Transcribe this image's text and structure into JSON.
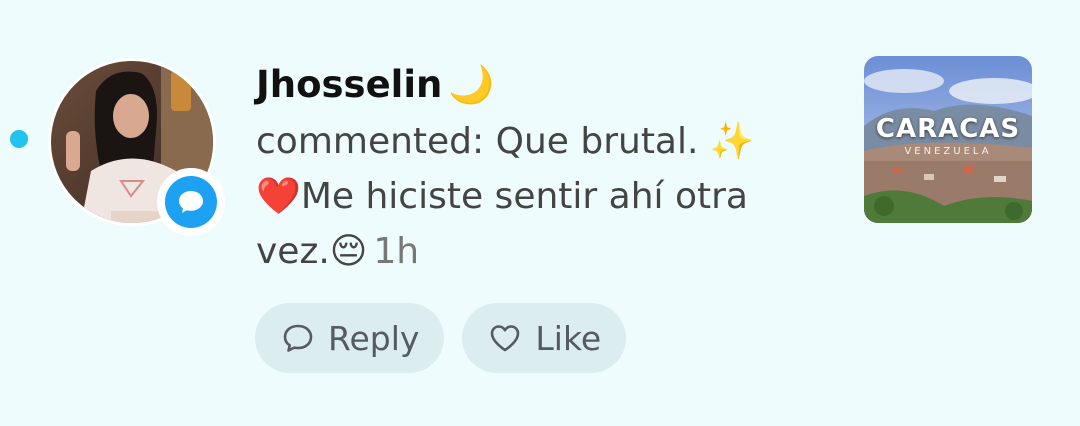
{
  "notification": {
    "username": "Jhosselin",
    "username_emoji": "🌙",
    "comment_prefix": "commented: Que brutal.",
    "sparkle_emoji": "✨",
    "heart_emoji": "❤️",
    "comment_line2": "Me hiciste sentir ahí otra vez.",
    "pensive_emoji": "😔",
    "time_ago": "1h"
  },
  "actions": {
    "reply_label": "Reply",
    "like_label": "Like"
  },
  "thumbnail": {
    "title": "CARACAS",
    "subtitle": "VENEZUELA"
  },
  "colors": {
    "background": "#effcfd",
    "unread_dot": "#22c3ee",
    "badge": "#1da1f2",
    "pill_bg": "#dcedef"
  },
  "icons": {
    "badge": "comment-bubble-icon",
    "reply": "speech-bubble-icon",
    "like": "heart-outline-icon"
  }
}
